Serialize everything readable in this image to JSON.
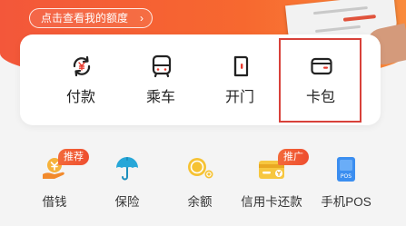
{
  "header": {
    "quota_link": "点击查看我的额度",
    "chevron": "›"
  },
  "quick_actions": [
    {
      "label": "付款",
      "icon": "yuan-cycle-icon"
    },
    {
      "label": "乘车",
      "icon": "bus-icon"
    },
    {
      "label": "开门",
      "icon": "door-icon"
    },
    {
      "label": "卡包",
      "icon": "card-wallet-icon"
    }
  ],
  "services": [
    {
      "label": "借钱",
      "icon": "gold-coin-hand-icon",
      "badge": "推荐"
    },
    {
      "label": "保险",
      "icon": "umbrella-icon"
    },
    {
      "label": "余额",
      "icon": "coins-icon"
    },
    {
      "label": "信用卡还款",
      "icon": "credit-card-icon",
      "badge": "推广"
    },
    {
      "label": "手机POS",
      "icon": "pos-terminal-icon",
      "icon_text": "POS"
    }
  ],
  "colors": {
    "brand": "#f3573a",
    "highlight": "#d8413a"
  }
}
